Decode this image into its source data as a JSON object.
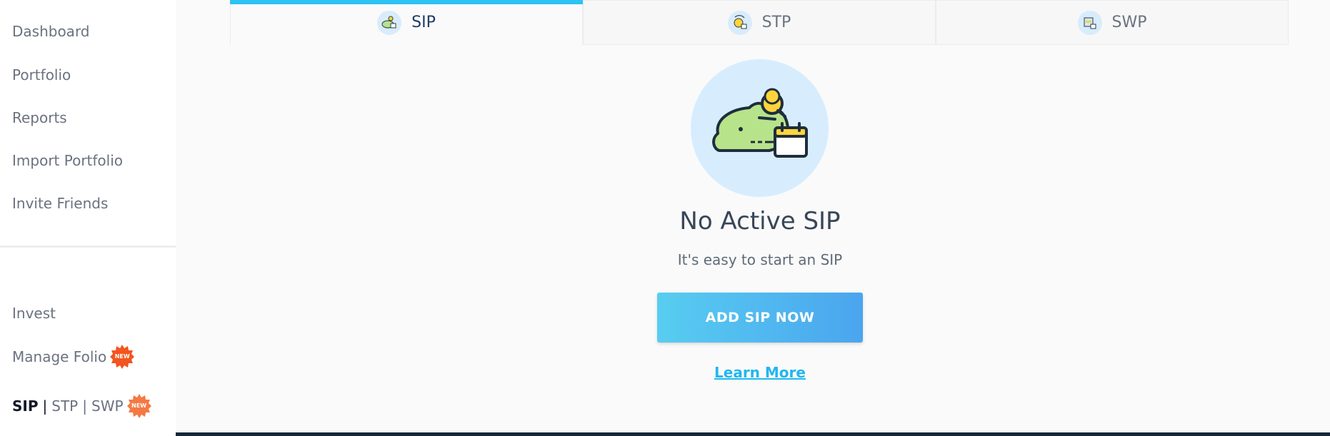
{
  "sidebar": {
    "items": [
      {
        "label": "Dashboard"
      },
      {
        "label": "Portfolio"
      },
      {
        "label": "Reports"
      },
      {
        "label": "Import Portfolio"
      },
      {
        "label": "Invite Friends"
      }
    ],
    "bottom_items": [
      {
        "label": "Invest"
      },
      {
        "label": "Manage Folio",
        "badge": "NEW"
      }
    ],
    "sip_row": {
      "sip": "SIP",
      "stp": "STP",
      "swp": "SWP",
      "sep1": "|",
      "sep2": "|",
      "badge": "NEW"
    }
  },
  "tabs": [
    {
      "label": "SIP",
      "icon": "piggy-bank-icon",
      "active": true
    },
    {
      "label": "STP",
      "icon": "coin-transfer-icon",
      "active": false
    },
    {
      "label": "SWP",
      "icon": "withdraw-icon",
      "active": false
    }
  ],
  "empty_state": {
    "icon": "piggy-bank-calendar-icon",
    "title": "No Active SIP",
    "subtitle": "It's easy to start an SIP",
    "button_label": "ADD SIP NOW",
    "link_label": "Learn More"
  },
  "colors": {
    "accent": "#2dc3f3",
    "button_start": "#58cdf0",
    "button_end": "#4aa5ef",
    "badge": "#f2551f",
    "footer_bar": "#17263a"
  }
}
